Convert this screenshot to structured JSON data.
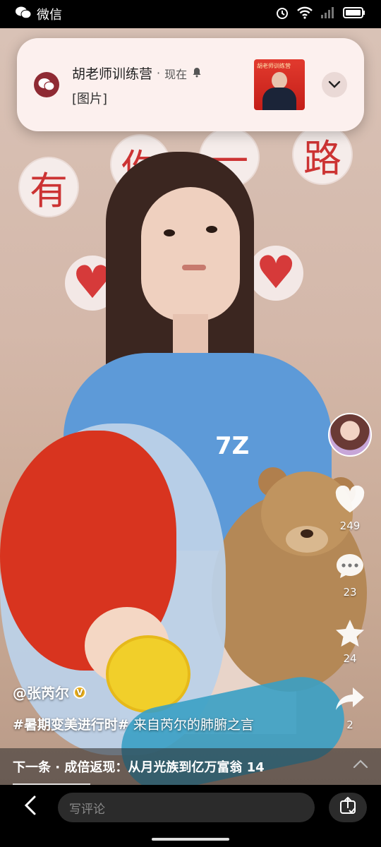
{
  "status_bar": {
    "app_name": "微信",
    "icons": [
      "wechat-icon",
      "alarm-icon",
      "wifi-icon",
      "signal-icon",
      "battery-icon"
    ]
  },
  "notification": {
    "app_icon": "wechat-icon",
    "title": "胡老师训练营",
    "separator": "·",
    "time": "现在",
    "bell_icon": "bell-icon",
    "body": "[图片]",
    "thumbnail_text": "胡老师训练营",
    "expand_icon": "chevron-down-icon"
  },
  "background_decor": [
    "有",
    "你",
    "一",
    "路"
  ],
  "video": {
    "shirt_logo": "7Z"
  },
  "right_rail": {
    "likes": "249",
    "comments": "23",
    "favorites": "24",
    "shares": "2"
  },
  "post": {
    "author": "@张芮尔",
    "hashtag": "#暑期变美进行时#",
    "caption": " 来自芮尔的肺腑之言"
  },
  "next_bar": {
    "text": "下一条 · 成倍返现：从月光族到亿万富翁 14"
  },
  "toolbar": {
    "comment_placeholder": "写评论"
  },
  "colors": {
    "status_bar_bg": "#000000",
    "notification_bg": "#fcf0ee",
    "toolbar_bg": "#000000",
    "input_bg": "#2b2b2b",
    "verified_badge": "#f2b51d"
  }
}
